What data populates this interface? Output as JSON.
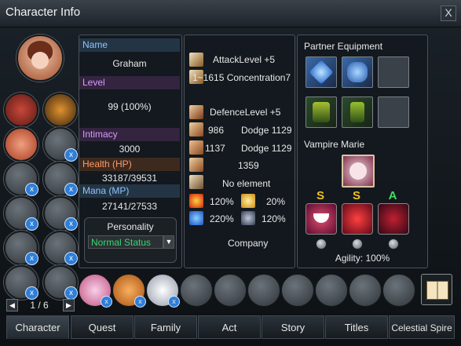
{
  "window": {
    "title": "Character Info",
    "close_label": "X"
  },
  "profile": {
    "name_label": "Name",
    "name": "Graham",
    "level_label": "Level",
    "level": "99 (100%)",
    "intimacy_label": "Intimacy",
    "intimacy": "3000",
    "health_label": "Health (HP)",
    "health": "33187/39531",
    "mana_label": "Mana (MP)",
    "mana": "27141/27533",
    "personality_label": "Personality",
    "personality": "Normal Status"
  },
  "stats": {
    "attack": "AttackLevel  +5",
    "attack_range": "1~1615 Concentration7",
    "defence": "DefenceLevel  +5",
    "def_a": "986",
    "dodge_a": "Dodge 1129",
    "def_b": "1137",
    "dodge_b": "Dodge 1129",
    "speed": "1359",
    "element": "No element",
    "fire": "120%",
    "light": "20%",
    "water": "220%",
    "dark": "120%",
    "company": "Company"
  },
  "partner": {
    "title": "Partner Equipment",
    "name": "Vampire Marie",
    "grades": [
      "S",
      "S",
      "A"
    ],
    "agility": "Agility: 100%"
  },
  "pager": {
    "text": "1 / 6"
  },
  "tabs": [
    "Character",
    "Quest",
    "Family",
    "Act",
    "Story",
    "Titles",
    "Celestial Spire"
  ],
  "colors": {
    "label_blue": "#8fc4ff",
    "label_purple": "#d79cff",
    "label_orange": "#ff9a66",
    "personality_green": "#37d86b"
  }
}
